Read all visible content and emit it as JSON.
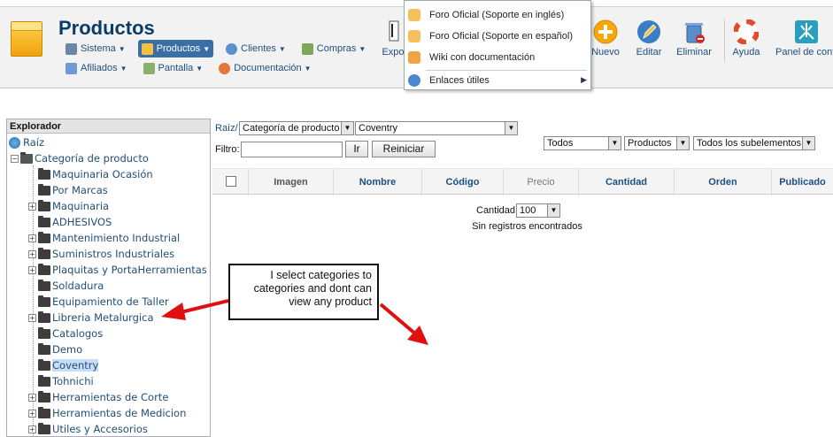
{
  "header": {
    "title": "Productos",
    "menu_row1": [
      {
        "label": "Sistema",
        "icon": "tools-icon",
        "active": false
      },
      {
        "label": "Productos",
        "icon": "box-icon",
        "active": true
      },
      {
        "label": "Clientes",
        "icon": "users-icon",
        "active": false
      },
      {
        "label": "Compras",
        "icon": "cart-icon",
        "active": false
      }
    ],
    "menu_row2": [
      {
        "label": "Afiliados",
        "icon": "affiliates-icon"
      },
      {
        "label": "Pantalla",
        "icon": "screen-icon"
      },
      {
        "label": "Documentación",
        "icon": "lifebuoy-icon"
      }
    ]
  },
  "help_menu": {
    "items": [
      {
        "label": "Foro Oficial (Soporte en inglés)",
        "icon": "forum-icon"
      },
      {
        "label": "Foro Oficial (Soporte en español)",
        "icon": "forum-icon"
      },
      {
        "label": "Wiki con documentación",
        "icon": "wiki-icon"
      },
      {
        "label": "Enlaces útiles",
        "icon": "link-icon",
        "submenu": true
      }
    ]
  },
  "toolbar": {
    "export_label": "Expo",
    "new_label": "Nuevo",
    "edit_label": "Editar",
    "delete_label": "Eliminar",
    "help_label": "Ayuda",
    "panel_label": "Panel de cont"
  },
  "explorer": {
    "title": "Explorador",
    "root": "Raíz",
    "category_root": "Categoría de producto",
    "children": [
      {
        "label": "Maquinaria Ocasión",
        "expandable": false
      },
      {
        "label": "Por Marcas",
        "expandable": false
      },
      {
        "label": "Maquinaria",
        "expandable": true
      },
      {
        "label": "ADHESIVOS",
        "expandable": false
      },
      {
        "label": "Mantenimiento Industrial",
        "expandable": true
      },
      {
        "label": "Suministros Industriales",
        "expandable": true
      },
      {
        "label": "Plaquitas y PortaHerramientas",
        "expandable": true
      },
      {
        "label": "Soldadura",
        "expandable": false
      },
      {
        "label": "Equipamiento de Taller",
        "expandable": false
      },
      {
        "label": "Libreria Metalurgica",
        "expandable": true
      },
      {
        "label": "Catalogos",
        "expandable": false
      },
      {
        "label": "Demo",
        "expandable": false
      },
      {
        "label": "Coventry",
        "expandable": false,
        "selected": true
      },
      {
        "label": "Tohnichi",
        "expandable": false
      },
      {
        "label": "Herramientas de Corte",
        "expandable": true
      },
      {
        "label": "Herramientas de Medicion",
        "expandable": true
      },
      {
        "label": "Utiles y Accesorios",
        "expandable": true
      }
    ]
  },
  "main": {
    "breadcrumb_root": "Raíz/",
    "category_type": "Categoría de producto",
    "category_value": "Coventry",
    "filter_label": "Filtro:",
    "filter_value": "",
    "go_button": "Ir",
    "reset_button": "Reiniciar",
    "scope_select": "Todos",
    "type_select": "Productos",
    "sub_select": "Todos los subelementos",
    "columns": [
      "Imagen",
      "Nombre",
      "Código",
      "Precio",
      "Cantidad",
      "Orden",
      "Publicado"
    ],
    "quantity_label": "Cantidad",
    "quantity_value": "100",
    "empty_message": "Sin registros encontrados"
  },
  "annotation": {
    "text": "I select  categories to categories and dont can view any product",
    "color": "#e01010"
  }
}
